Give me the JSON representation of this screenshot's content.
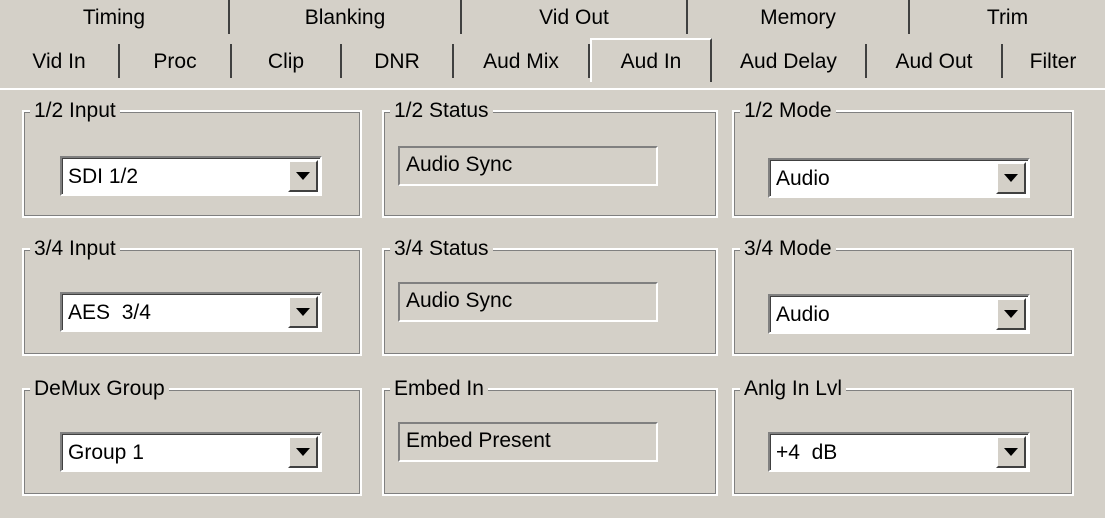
{
  "tabs_back": [
    "Timing",
    "Blanking",
    "Vid Out",
    "Memory",
    "Trim"
  ],
  "tabs_front": [
    "Vid In",
    "Proc",
    "Clip",
    "DNR",
    "Aud Mix",
    "Aud In",
    "Aud Delay",
    "Aud Out",
    "Filter"
  ],
  "active_tab": "Aud In",
  "groups": {
    "input12": {
      "legend": "1/2 Input",
      "value": "SDI 1/2"
    },
    "status12": {
      "legend": "1/2 Status",
      "value": "Audio Sync"
    },
    "mode12": {
      "legend": "1/2 Mode",
      "value": "Audio"
    },
    "input34": {
      "legend": "3/4 Input",
      "value": "AES  3/4"
    },
    "status34": {
      "legend": "3/4 Status",
      "value": "Audio Sync"
    },
    "mode34": {
      "legend": "3/4 Mode",
      "value": "Audio"
    },
    "demux": {
      "legend": "DeMux Group",
      "value": "Group 1"
    },
    "embed": {
      "legend": "Embed In",
      "value": "Embed Present"
    },
    "anlg": {
      "legend": "Anlg In Lvl",
      "value": "+4  dB"
    }
  },
  "icons": {
    "dropdown": "chevron-down-icon"
  },
  "colors": {
    "face": "#d4d0c8",
    "highlight": "#ffffff",
    "shadow": "#808080",
    "dark_shadow": "#404040"
  }
}
